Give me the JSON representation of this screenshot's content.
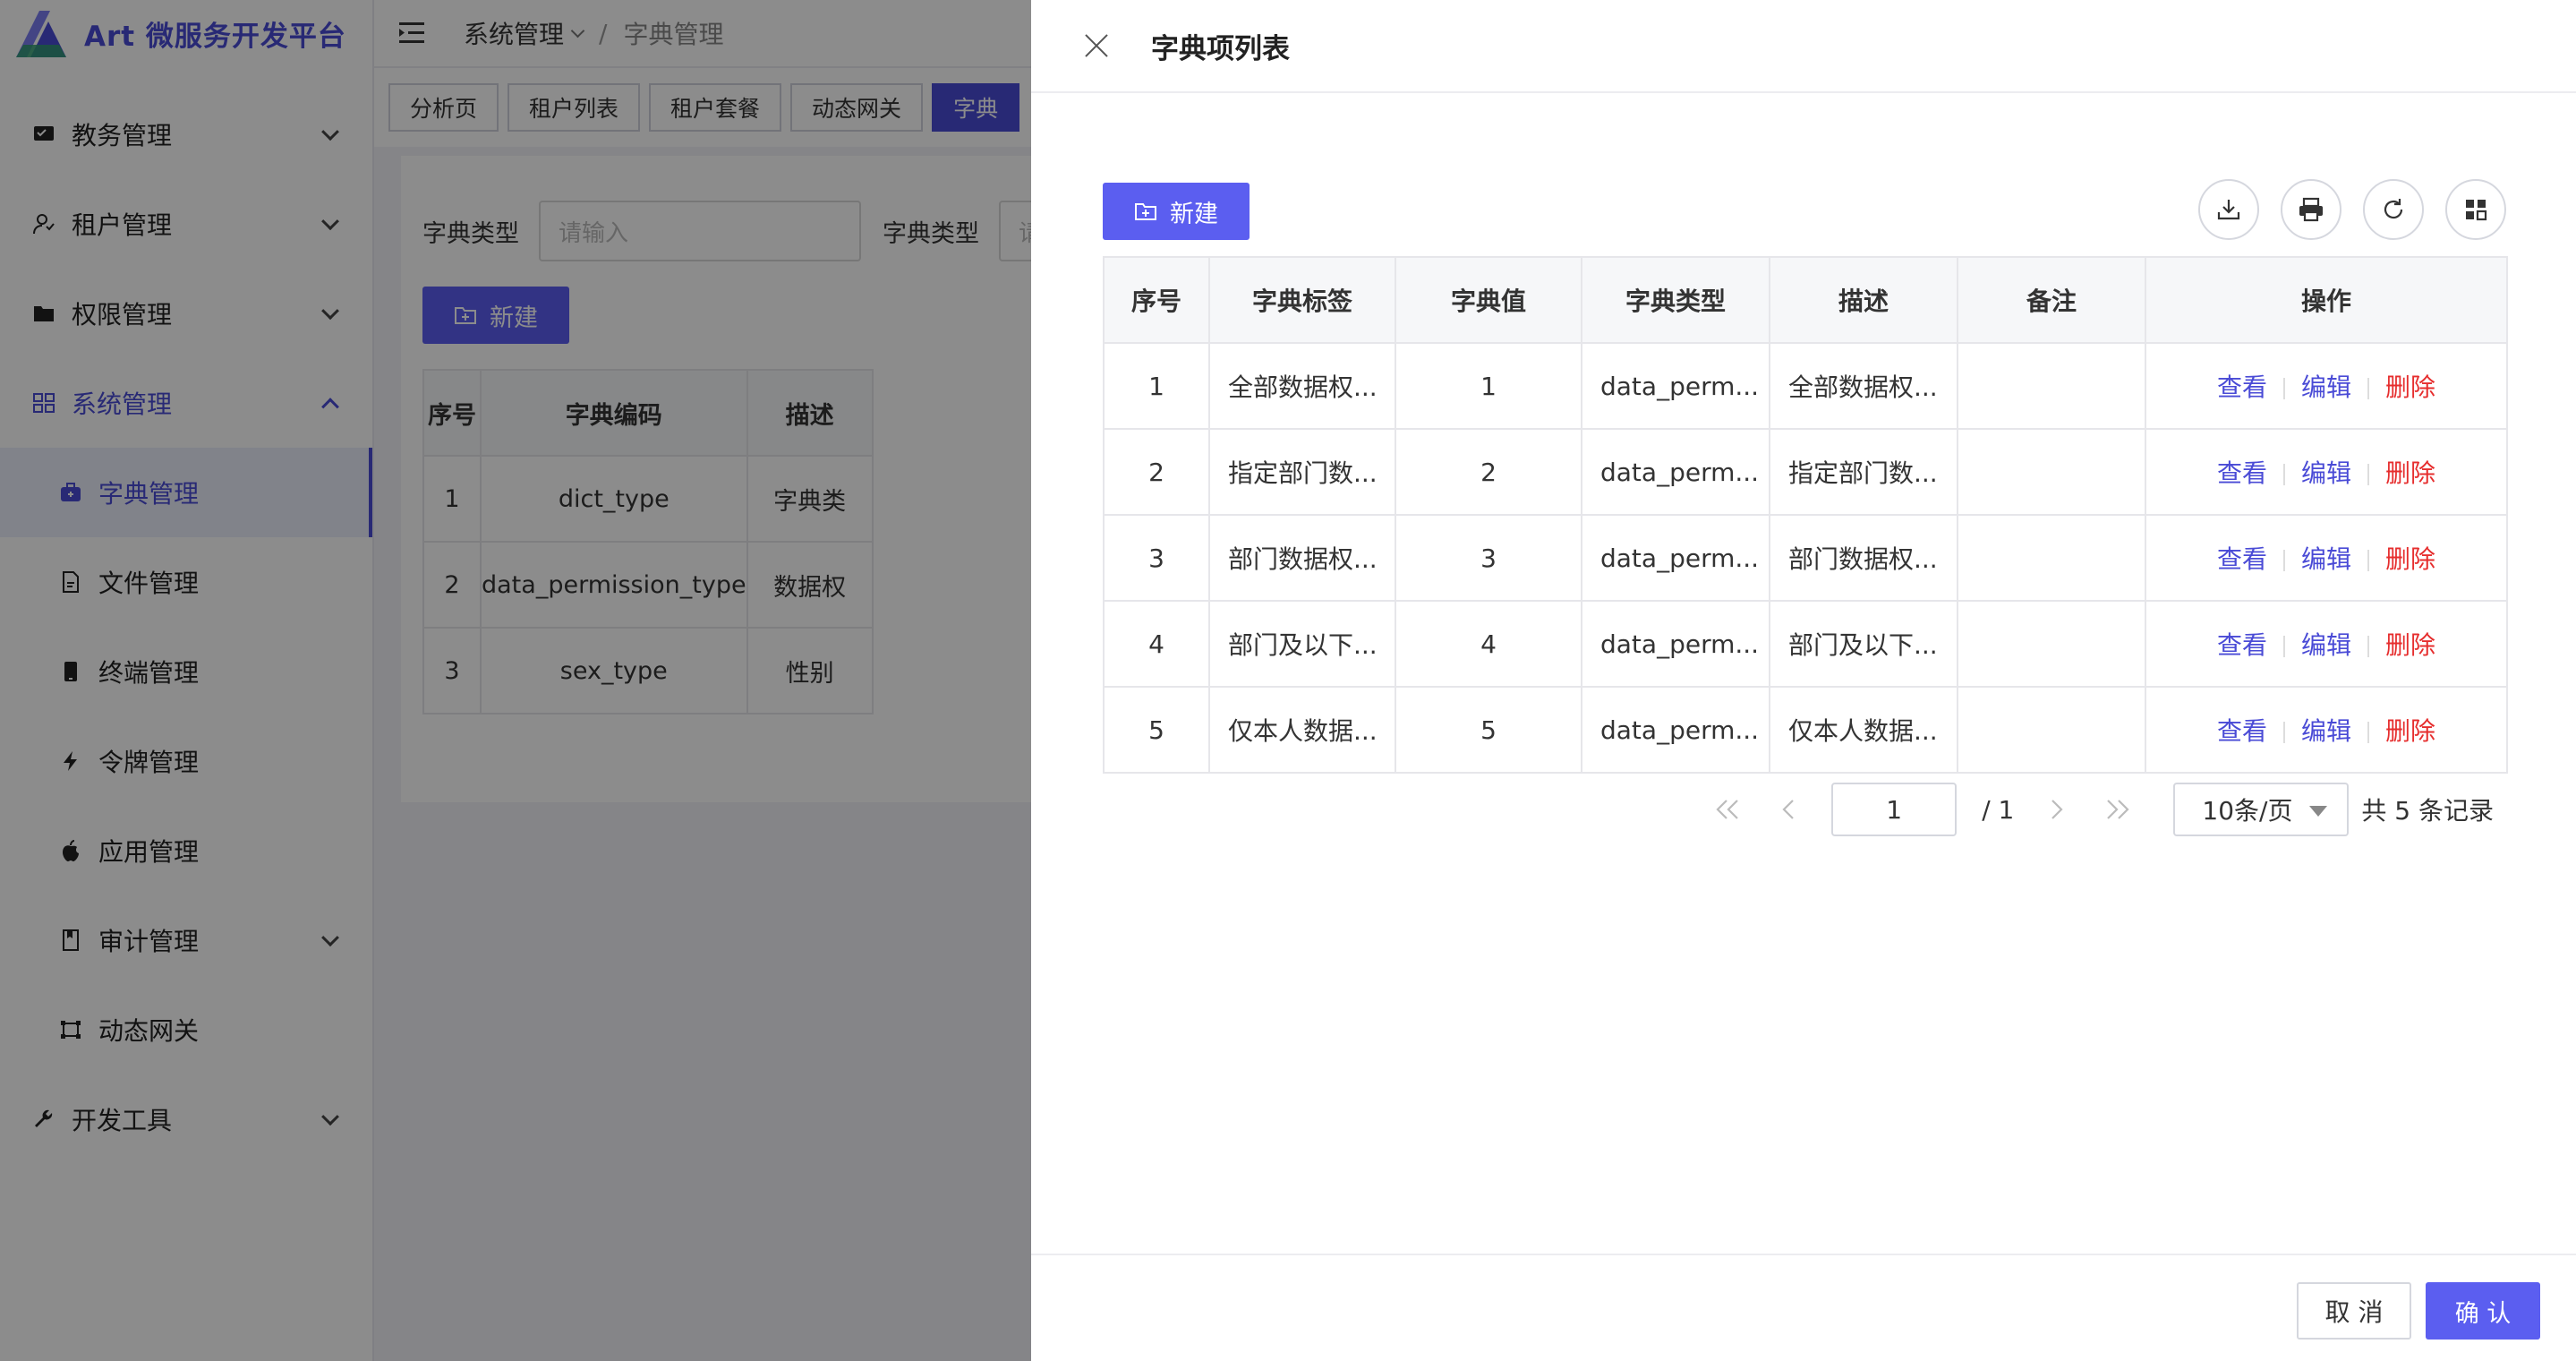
{
  "app": {
    "title": "Art 微服务开发平台"
  },
  "sidebar": {
    "items": [
      {
        "label": "教务管理",
        "icon": "monitor-icon",
        "expandable": true
      },
      {
        "label": "租户管理",
        "icon": "user-icon",
        "expandable": true
      },
      {
        "label": "权限管理",
        "icon": "folder-icon",
        "expandable": true
      },
      {
        "label": "系统管理",
        "icon": "grid-icon",
        "expandable": true,
        "open": true
      },
      {
        "label": "字典管理",
        "icon": "briefcase-icon",
        "sub": true,
        "active": true
      },
      {
        "label": "文件管理",
        "icon": "file-icon",
        "sub": true
      },
      {
        "label": "终端管理",
        "icon": "phone-icon",
        "sub": true
      },
      {
        "label": "令牌管理",
        "icon": "bolt-icon",
        "sub": true
      },
      {
        "label": "应用管理",
        "icon": "apple-icon",
        "sub": true
      },
      {
        "label": "审计管理",
        "icon": "book-icon",
        "sub": true,
        "expandable": true
      },
      {
        "label": "动态网关",
        "icon": "gateway-icon",
        "sub": true
      },
      {
        "label": "开发工具",
        "icon": "wrench-icon",
        "expandable": true
      }
    ]
  },
  "header": {
    "breadcrumb": [
      "系统管理",
      "字典管理"
    ]
  },
  "tabs": [
    "分析页",
    "租户列表",
    "租户套餐",
    "动态网关",
    "字典"
  ],
  "background_page": {
    "search_label_1": "字典类型",
    "search_placeholder_1": "请输入",
    "search_label_2": "字典类型",
    "search_placeholder_2": "请",
    "new_label": "新建",
    "columns": [
      "序号",
      "字典编码",
      "描述"
    ],
    "rows": [
      [
        "1",
        "dict_type",
        "字典类"
      ],
      [
        "2",
        "data_permission_type",
        "数据权"
      ],
      [
        "3",
        "sex_type",
        "性别"
      ]
    ]
  },
  "drawer": {
    "title": "字典项列表",
    "new_label": "新建",
    "tools": [
      "download-icon",
      "print-icon",
      "refresh-icon",
      "columns-icon"
    ],
    "columns": [
      "序号",
      "字典标签",
      "字典值",
      "字典类型",
      "描述",
      "备注",
      "操作"
    ],
    "rows": [
      {
        "no": "1",
        "label": "全部数据权...",
        "value": "1",
        "type": "data_perm...",
        "desc": "全部数据权...",
        "remark": ""
      },
      {
        "no": "2",
        "label": "指定部门数...",
        "value": "2",
        "type": "data_perm...",
        "desc": "指定部门数...",
        "remark": ""
      },
      {
        "no": "3",
        "label": "部门数据权...",
        "value": "3",
        "type": "data_perm...",
        "desc": "部门数据权...",
        "remark": ""
      },
      {
        "no": "4",
        "label": "部门及以下...",
        "value": "4",
        "type": "data_perm...",
        "desc": "部门及以下...",
        "remark": ""
      },
      {
        "no": "5",
        "label": "仅本人数据...",
        "value": "5",
        "type": "data_perm...",
        "desc": "仅本人数据...",
        "remark": ""
      }
    ],
    "actions": {
      "view": "查看",
      "edit": "编辑",
      "delete": "删除"
    },
    "pager": {
      "current": "1",
      "total_pages": "/ 1",
      "page_size": "10条/页",
      "total": "共 5 条记录"
    },
    "footer": {
      "cancel": "取 消",
      "ok": "确 认"
    }
  },
  "colors": {
    "primary": "#5b5ef0",
    "danger": "#e62e2e",
    "mask": "rgba(0,0,0,0.45)"
  }
}
